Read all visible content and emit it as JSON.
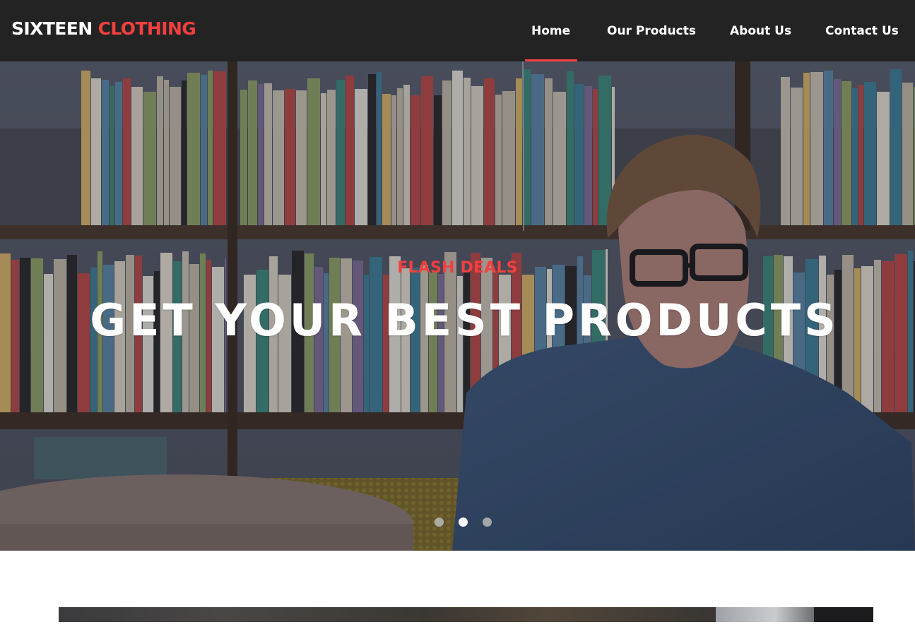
{
  "header": {
    "brand_primary": "SIXTEEN",
    "brand_accent": "CLOTHING",
    "nav": [
      {
        "label": "Home",
        "active": true
      },
      {
        "label": "Our Products",
        "active": false
      },
      {
        "label": "About Us",
        "active": false
      },
      {
        "label": "Contact Us",
        "active": false
      }
    ]
  },
  "hero": {
    "eyebrow": "FLASH DEALS",
    "title": "GET YOUR BEST PRODUCTS",
    "image": "bookshelf-man-glasses-photo",
    "slides_total": 3,
    "active_slide": 2
  },
  "colors": {
    "accent": "#f33f3f",
    "header_bg": "#232323",
    "text_light": "#ffffff"
  }
}
